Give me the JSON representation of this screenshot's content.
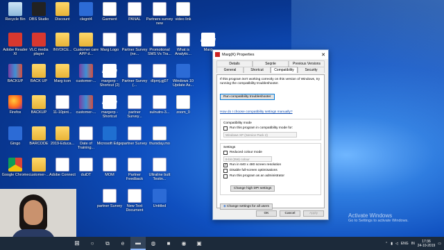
{
  "desktop": {
    "icons": [
      {
        "label": "Recycle Bin",
        "icon": "recycle-bin-icon"
      },
      {
        "label": "OBS Studio",
        "icon": "obs-icon"
      },
      {
        "label": "Discount",
        "icon": "folder-icon"
      },
      {
        "label": "clegnt4",
        "icon": "app-icon"
      },
      {
        "label": "Garment",
        "icon": "video-icon"
      },
      {
        "label": "PANAL",
        "icon": "document-icon"
      },
      {
        "label": "Partners survey new",
        "icon": "document-icon"
      },
      {
        "label": "video link",
        "icon": "video-icon"
      },
      {
        "label": "Adobe Reader XI",
        "icon": "adobe-icon"
      },
      {
        "label": "VLC media player",
        "icon": "vlc-icon"
      },
      {
        "label": "INVOICE...",
        "icon": "folder-icon"
      },
      {
        "label": "Customer care APP d...",
        "icon": "folder-icon"
      },
      {
        "label": "Marg Logo",
        "icon": "document-icon"
      },
      {
        "label": "Partner Survey (ne...",
        "icon": "document-icon"
      },
      {
        "label": "Promotional SMS Vs Tra...",
        "icon": "document-icon"
      },
      {
        "label": "What is Analytic...",
        "icon": "document-icon"
      },
      {
        "label": "Marg",
        "icon": "marg-icon"
      },
      {
        "label": "BACKUP",
        "icon": "rar-icon"
      },
      {
        "label": "BACK UP",
        "icon": "folder-icon"
      },
      {
        "label": "Marg icon",
        "icon": "folder-icon"
      },
      {
        "label": "customer-...",
        "icon": "rar-icon"
      },
      {
        "label": "margerp - Shortcut (2)",
        "icon": "marg-icon"
      },
      {
        "label": "Partner Survey (...",
        "icon": "document-icon"
      },
      {
        "label": "dlprnj.gj07",
        "icon": "document-icon"
      },
      {
        "label": "Windows 10 Update As...",
        "icon": "windows-update-icon"
      },
      {
        "label": "Firefox",
        "icon": "firefox-icon"
      },
      {
        "label": "BACKUP",
        "icon": "folder-icon"
      },
      {
        "label": "11-10pint...",
        "icon": "document-icon"
      },
      {
        "label": "customer-...",
        "icon": "rar-icon"
      },
      {
        "label": "margerp - Shortcut",
        "icon": "marg-icon"
      },
      {
        "label": "partner Survey...",
        "icon": "document-icon"
      },
      {
        "label": "sulnutrs-3...",
        "icon": "document-icon"
      },
      {
        "label": "zoom_0",
        "icon": "video-icon"
      },
      {
        "label": "Gingo",
        "icon": "app-icon"
      },
      {
        "label": "BARCODE",
        "icon": "folder-icon"
      },
      {
        "label": "2019-Educa...",
        "icon": "folder-icon"
      },
      {
        "label": "Date of Training...",
        "icon": "document-icon"
      },
      {
        "label": "Microsoft Edge",
        "icon": "edge-icon"
      },
      {
        "label": "partner Survey",
        "icon": "document-icon"
      },
      {
        "label": "thursday.mo",
        "icon": "video-icon"
      },
      {
        "label": "Google Chrome",
        "icon": "chrome-icon"
      },
      {
        "label": "customer-...",
        "icon": "folder-icon"
      },
      {
        "label": "Adobe Connect",
        "icon": "document-icon"
      },
      {
        "label": "duiDT",
        "icon": "document-icon"
      },
      {
        "label": "MOM",
        "icon": "document-icon"
      },
      {
        "label": "Partner Feedback",
        "icon": "document-icon"
      },
      {
        "label": "Ultraline butt Testin...",
        "icon": "document-icon"
      },
      {
        "label": "partner Survey",
        "icon": "document-icon"
      },
      {
        "label": "margerp-U...",
        "icon": "document-icon"
      },
      {
        "label": "New Text Document",
        "icon": "document-icon"
      },
      {
        "label": "Untitled",
        "icon": "image-icon"
      }
    ]
  },
  "dialog": {
    "title": "Marg(K) Properties",
    "close_glyph": "✕",
    "tabs_row1": [
      "Details",
      "Seqnle",
      "Previous Versions"
    ],
    "tabs_row2": [
      "General",
      "Shortcut",
      "Compatibility",
      "Security"
    ],
    "intro": "If this program isn't working correctly on this version of Windows, try running the compatibility troubleshooter.",
    "troubleshooter_btn": "Run compatibility troubleshooter",
    "manual_link": "How do I choose compatibility settings manually?",
    "compat_mode": {
      "title": "Compatibility mode",
      "checkbox": "Run this program in compatibility mode for:",
      "select": "Windows XP (Service Pack 2)"
    },
    "settings": {
      "title": "Settings",
      "reduced_colour": "Reduced colour mode",
      "colour_select": "8-bit (256) colour",
      "res_640": "Run in 640 x 480 screen resolution",
      "disable_fullscreen": "Disable full-screen optimisations",
      "admin": "Run this program as an administrator",
      "dpi_btn": "Change high DPI settings"
    },
    "all_users_btn": "Change settings for all users",
    "ok": "OK",
    "cancel": "Cancel",
    "apply": "Apply"
  },
  "activation": {
    "line1": "Activate Windows",
    "line2": "Go to Settings to activate Windows."
  },
  "taskbar": {
    "start_glyph": "⊞",
    "items": [
      "○",
      "⧉",
      "e",
      "▬",
      "◍",
      "■",
      "◉",
      "▣"
    ],
    "tray_lang": "ENG",
    "tray_region": "IN",
    "time": "17:36",
    "date": "24-10-2019"
  },
  "colors": {
    "accent": "#0078d7",
    "taskbar": "#1c2a3a"
  }
}
